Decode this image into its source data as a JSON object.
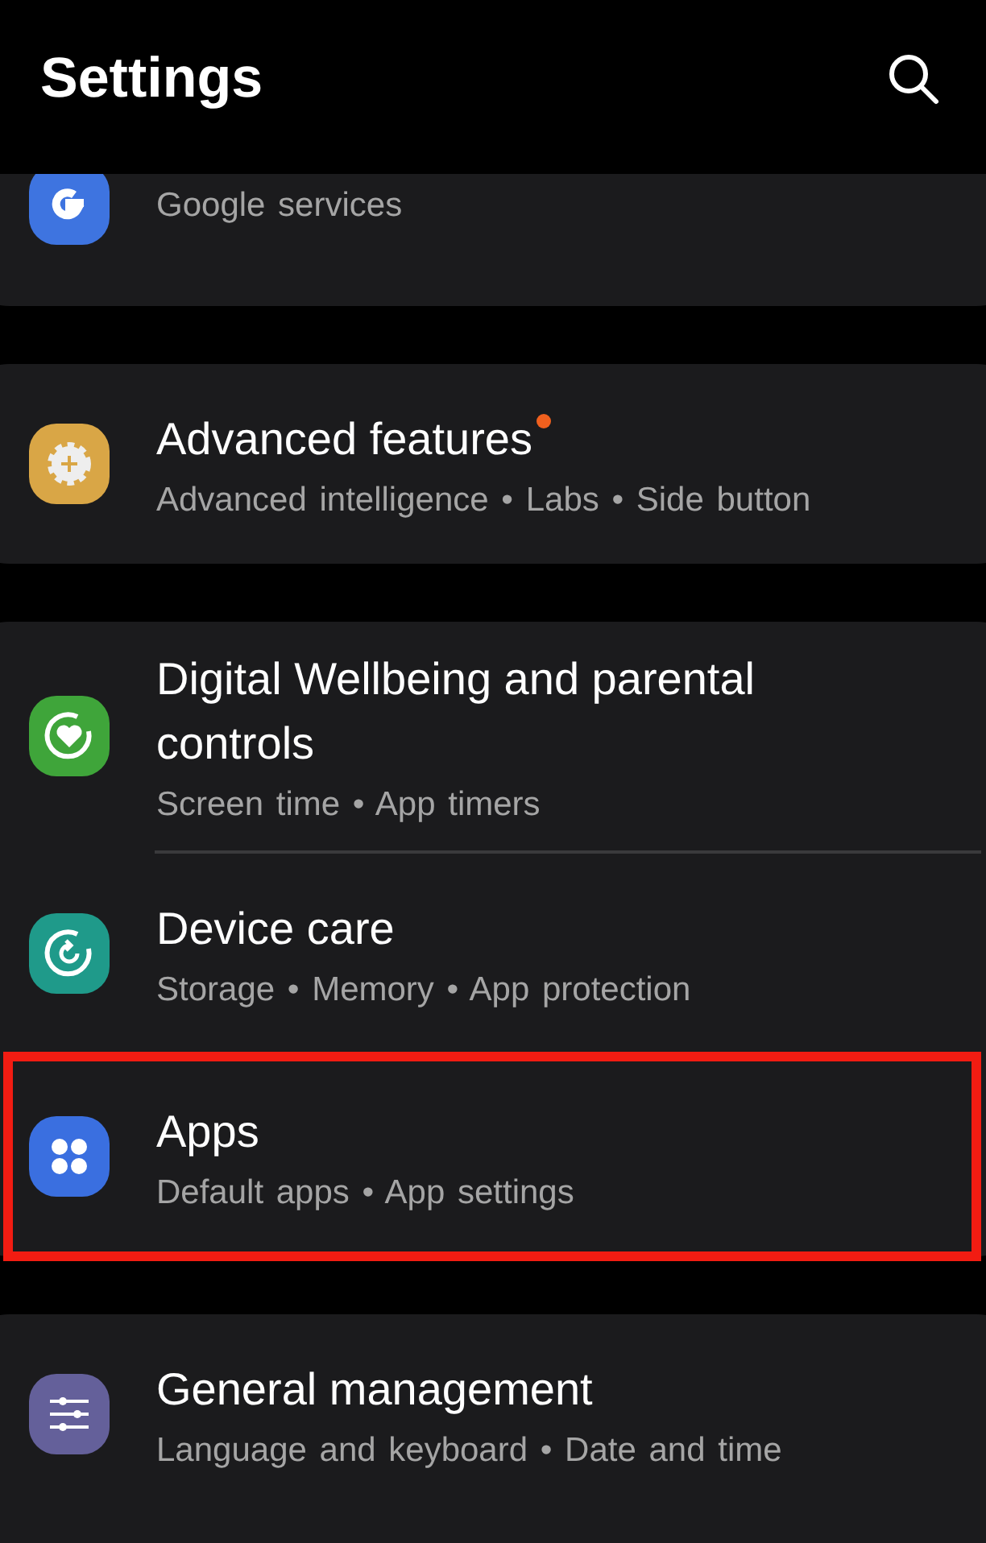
{
  "header": {
    "title": "Settings"
  },
  "groups": [
    {
      "items": [
        {
          "kind": "google",
          "color": "#3e74e0",
          "subtitle": "Google services",
          "badge": false,
          "highlighted": false
        }
      ]
    },
    {
      "items": [
        {
          "kind": "gear-plus",
          "color": "#d9a646",
          "title": "Advanced features",
          "subtitle": "Advanced intelligence • Labs • Side button",
          "badge": true,
          "highlighted": false
        }
      ]
    },
    {
      "items": [
        {
          "kind": "heart-ring",
          "color": "#3fa53a",
          "title": "Digital Wellbeing and parental controls",
          "subtitle": "Screen time • App timers",
          "badge": false,
          "highlighted": false
        },
        {
          "kind": "refresh-ring",
          "color": "#1f9a8a",
          "title": "Device care",
          "subtitle": "Storage • Memory • App protection",
          "badge": false,
          "highlighted": false
        },
        {
          "kind": "dots",
          "color": "#3a6fe0",
          "title": "Apps",
          "subtitle": "Default apps • App settings",
          "badge": false,
          "highlighted": true
        }
      ]
    },
    {
      "items": [
        {
          "kind": "sliders",
          "color": "#64609a",
          "title": "General management",
          "subtitle": "Language and keyboard • Date and time",
          "badge": false,
          "highlighted": false
        }
      ]
    }
  ]
}
